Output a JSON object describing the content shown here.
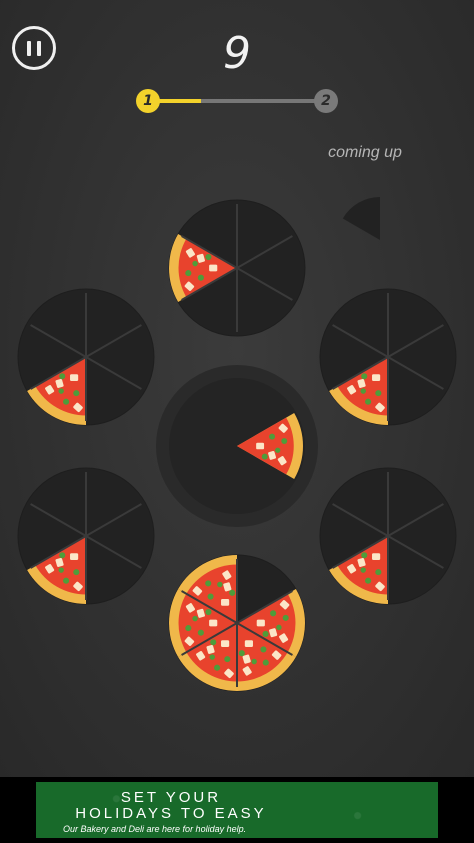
{
  "hud": {
    "score": "9",
    "level_current": "1",
    "level_next": "2",
    "level_progress": 0.3,
    "coming_up_label": "coming up",
    "pause_icon": "pause-icon"
  },
  "colors": {
    "plate": "#222222",
    "plate_rim": "#1e1e1e",
    "slot_line": "#3a3a3a",
    "crust": "#f0b84a",
    "crust_light": "#f7d06f",
    "sauce": "#e8432d",
    "cheese": "#fbe6c8",
    "basil": "#4f9c3a",
    "progress_fill": "#f3d22b"
  },
  "board": {
    "plates": [
      {
        "name": "plate-top",
        "filled_slices": [
          4
        ]
      },
      {
        "name": "plate-upper-left",
        "filled_slices": [
          3
        ]
      },
      {
        "name": "plate-upper-right",
        "filled_slices": [
          3
        ]
      },
      {
        "name": "plate-lower-left",
        "filled_slices": [
          3
        ]
      },
      {
        "name": "plate-lower-right",
        "filled_slices": [
          3
        ]
      },
      {
        "name": "plate-bottom",
        "filled_slices": [
          1,
          2,
          3,
          4,
          5
        ]
      }
    ],
    "center_slice": "pizza-slice",
    "next_piece_icon": "slice-preview-icon"
  },
  "ad": {
    "headline": "SET YOUR\nHOLIDAYS TO EASY",
    "subline": "Our Bakery and Deli are here for holiday help."
  }
}
